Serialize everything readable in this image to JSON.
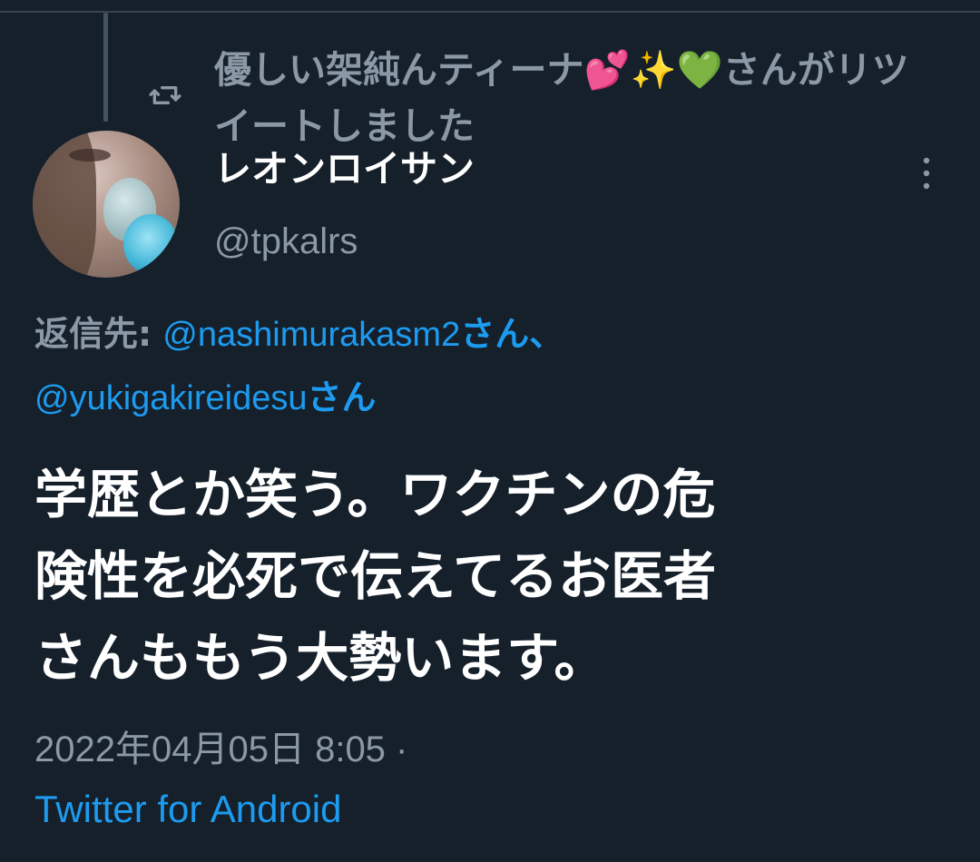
{
  "retweet": {
    "icon": "retweet-icon",
    "retweeter_name": "優しい架純んティーナ",
    "emoji_1": "💕",
    "emoji_2": "✨",
    "emoji_3": "💚",
    "suffix_line1": "さんがリツ",
    "suffix_line2": "イートしました"
  },
  "author": {
    "display_name": "レオンロイサン",
    "username": "@tpkalrs",
    "avatar": "avatar"
  },
  "menu": {
    "icon": "more-vertical-icon"
  },
  "reply": {
    "prefix": "返信先:",
    "mention_1": "@nashimurakasm2",
    "mention_1_suffix": "さん、",
    "mention_2": "@yukigakireidesu",
    "mention_2_suffix": "さん"
  },
  "tweet": {
    "lines": [
      "学歴とか笑う。ワクチンの危",
      "険性を必死で伝えてるお医者",
      "さんももう大勢います。"
    ]
  },
  "meta": {
    "timestamp": "2022年04月05日 8:05 ·",
    "source": "Twitter for Android"
  },
  "colors": {
    "background": "#15202b",
    "secondary_text": "#8b98a5",
    "primary_text": "#ffffff",
    "link": "#1d9bf0"
  }
}
